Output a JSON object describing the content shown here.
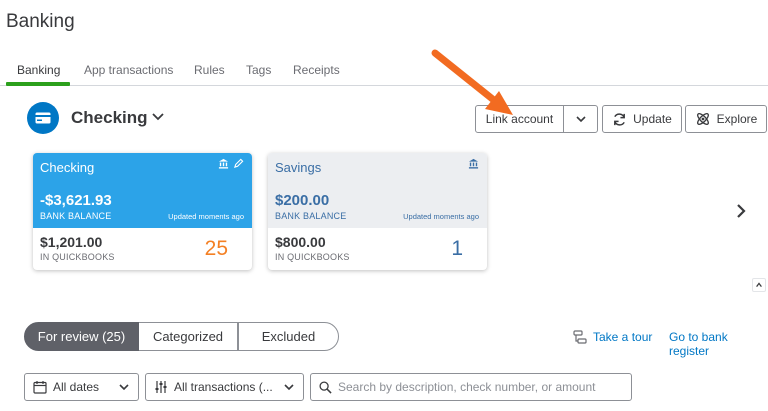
{
  "page": {
    "title": "Banking"
  },
  "tabs": [
    {
      "label": "Banking",
      "active": true
    },
    {
      "label": "App transactions",
      "active": false
    },
    {
      "label": "Rules",
      "active": false
    },
    {
      "label": "Tags",
      "active": false
    },
    {
      "label": "Receipts",
      "active": false
    }
  ],
  "account_selector": {
    "label": "Checking"
  },
  "toolbar": {
    "link_account": "Link account",
    "update": "Update",
    "explore": "Explore"
  },
  "cards": [
    {
      "name": "Checking",
      "bank_balance": "-$3,621.93",
      "bank_balance_label": "BANK BALANCE",
      "updated": "Updated moments ago",
      "qb_amount": "$1,201.00",
      "qb_label": "IN QUICKBOOKS",
      "count": "25",
      "selected": true
    },
    {
      "name": "Savings",
      "bank_balance": "$200.00",
      "bank_balance_label": "BANK BALANCE",
      "updated": "Updated moments ago",
      "qb_amount": "$800.00",
      "qb_label": "IN QUICKBOOKS",
      "count": "1",
      "selected": false
    }
  ],
  "review_tabs": [
    {
      "label": "For review (25)",
      "active": true
    },
    {
      "label": "Categorized",
      "active": false
    },
    {
      "label": "Excluded",
      "active": false
    }
  ],
  "links": {
    "take_tour": "Take a tour",
    "bank_register": "Go to bank register"
  },
  "filters": {
    "dates": "All dates",
    "transactions": "All transactions (...",
    "search_placeholder": "Search by description, check number, or amount"
  },
  "colors": {
    "accent_green": "#2ca01c",
    "primary_blue": "#0077c5",
    "selected_card": "#2ca3e8",
    "count_orange": "#f48024"
  }
}
